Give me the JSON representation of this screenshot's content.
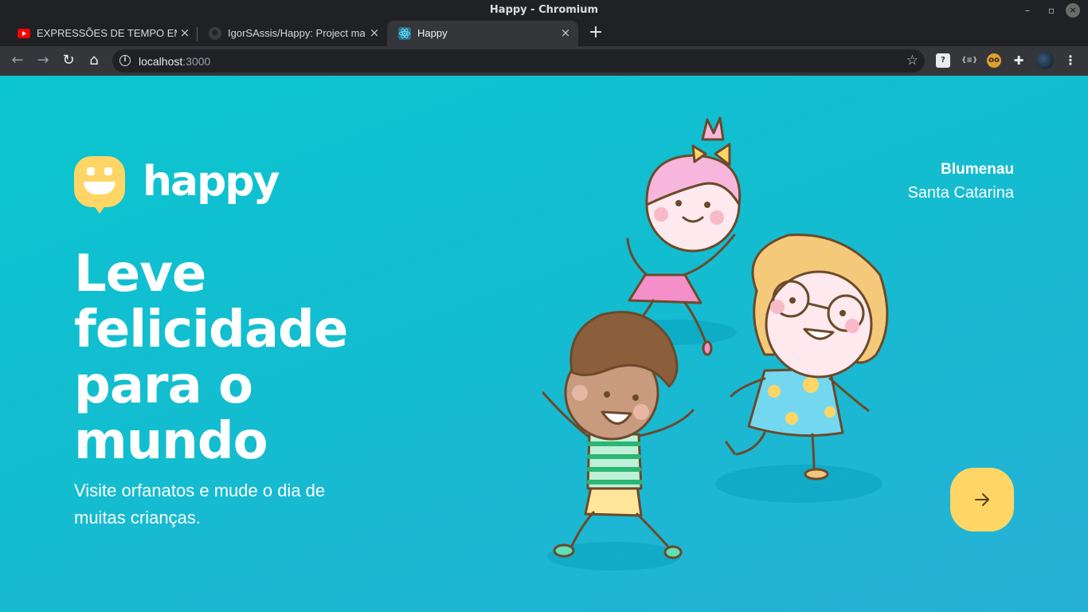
{
  "window": {
    "title": "Happy - Chromium"
  },
  "tabs": [
    {
      "label": "EXPRESSÕES DE TEMPO EM INGLÊS",
      "favicon": "youtube-icon"
    },
    {
      "label": "IgorSAssis/Happy: Project made",
      "favicon": "github-icon"
    },
    {
      "label": "Happy",
      "favicon": "react-icon"
    }
  ],
  "toolbar": {
    "url_host": "localhost",
    "url_port": ":3000"
  },
  "page": {
    "logo_text": "happy",
    "headline": "Leve felicidade para o mundo",
    "subline": "Visite orfanatos e mude o dia de muitas crianças.",
    "location": {
      "city": "Blumenau",
      "state": "Santa Catarina"
    }
  },
  "colors": {
    "accent": "#ffd666",
    "background_start": "#0bc5cf",
    "background_end": "#27b0d6"
  }
}
